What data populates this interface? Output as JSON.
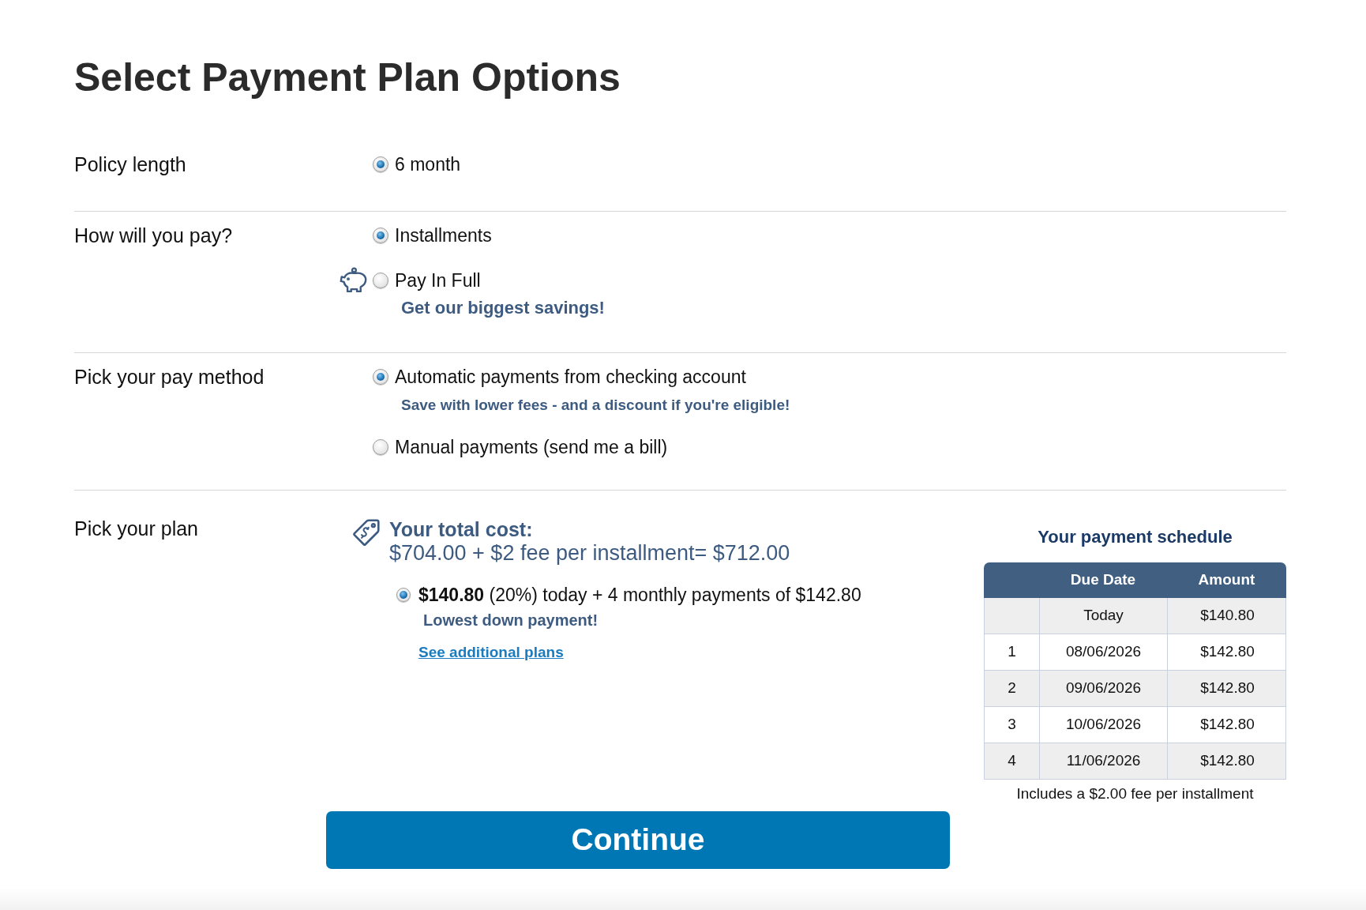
{
  "title": "Select Payment Plan Options",
  "sections": [
    {
      "label": "Policy length",
      "options": [
        {
          "label": "6 month",
          "selected": true
        }
      ]
    },
    {
      "label": "How will you pay?",
      "options": [
        {
          "label": "Installments",
          "selected": true
        },
        {
          "label": "Pay In Full",
          "selected": false,
          "note": "Get our biggest savings!"
        }
      ]
    },
    {
      "label": "Pick your pay method",
      "options": [
        {
          "label": "Automatic payments from checking account",
          "selected": true,
          "note": "Save with lower fees - and a discount if you're eligible!"
        },
        {
          "label": "Manual payments (send me a bill)",
          "selected": false
        }
      ]
    }
  ],
  "plan_section": {
    "label": "Pick your plan",
    "total_cost": {
      "heading": "Your total cost:",
      "amount": "$704.00 + $2 fee per installment= $712.00"
    },
    "plans": [
      {
        "text": "**$140.80** (20%) today + 4 monthly payments of $142.80",
        "note": "Lowest down payment!",
        "selected": true
      }
    ],
    "more_link": "See additional plans",
    "schedule": {
      "title": "Your payment schedule",
      "columns": [
        "Due Date",
        "Amount"
      ],
      "rows": [
        {
          "due_date": "Today",
          "amount": "$140.80"
        },
        {
          "number": "1",
          "due_date": "08/06/2026",
          "amount": "$142.80"
        },
        {
          "number": "2",
          "due_date": "09/06/2026",
          "amount": "$142.80"
        },
        {
          "number": "3",
          "due_date": "10/06/2026",
          "amount": "$142.80"
        },
        {
          "number": "4",
          "due_date": "11/06/2026",
          "amount": "$142.80"
        }
      ],
      "footnote": "Includes a $2.00 fee per installment"
    }
  },
  "continue_button": "Continue"
}
